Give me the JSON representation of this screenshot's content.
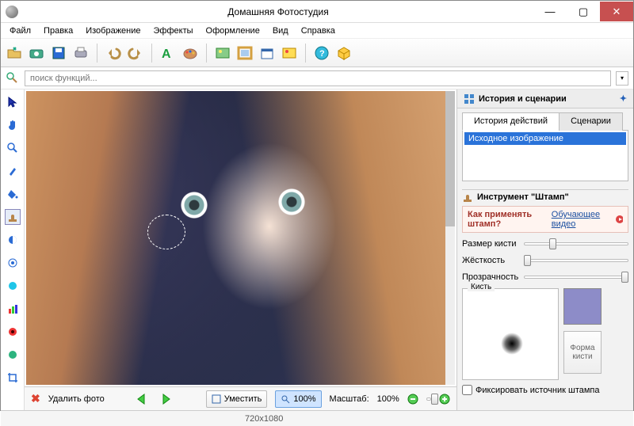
{
  "app": {
    "title": "Домашняя Фотостудия"
  },
  "menu": {
    "file": "Файл",
    "edit": "Правка",
    "image": "Изображение",
    "effects": "Эффекты",
    "design": "Оформление",
    "view": "Вид",
    "help": "Справка"
  },
  "search": {
    "placeholder": "поиск функций..."
  },
  "rightpanel": {
    "history_title": "История и сценарии",
    "tabs": {
      "history": "История действий",
      "scenarios": "Сценарии"
    },
    "history_item": "Исходное изображение",
    "tool_title": "Инструмент \"Штамп\"",
    "howto_label": "Как применять штамп?",
    "tutorial_link": "Обучающее видео",
    "sliders": {
      "size": "Размер кисти",
      "hardness": "Жёсткость",
      "opacity": "Прозрачность"
    },
    "brush_label": "Кисть",
    "shape_label": "Форма кисти",
    "fixate": "Фиксировать источник штампа"
  },
  "bottom": {
    "delete": "Удалить фото",
    "fit": "Уместить",
    "zoom_btn": "100%",
    "scale_label": "Масштаб:",
    "scale_value": "100%"
  },
  "status": {
    "dims": "720x1080"
  },
  "chart_data": null
}
